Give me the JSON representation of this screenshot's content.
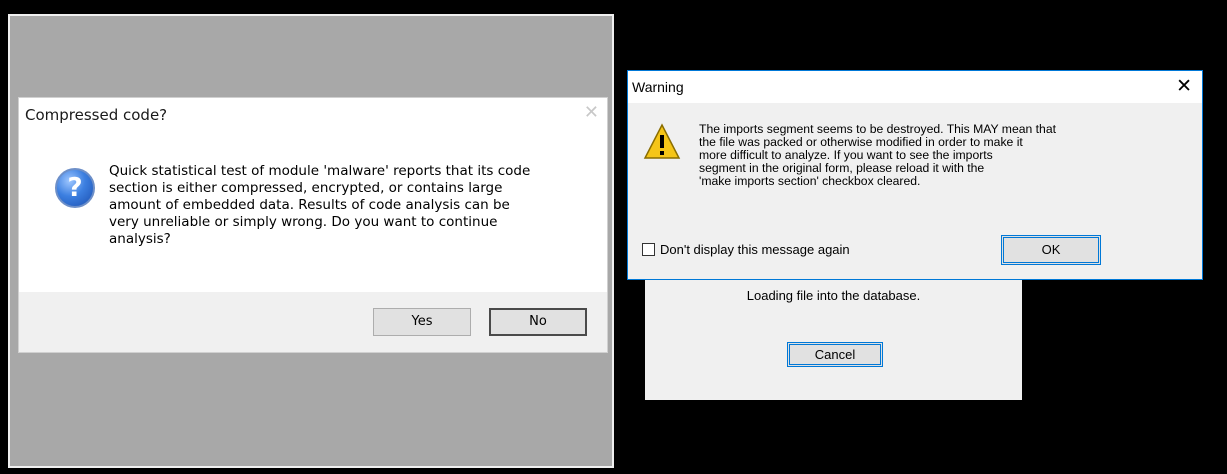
{
  "left_dialog": {
    "title": "Compressed code?",
    "close_glyph": "✕",
    "icon": "question-icon",
    "icon_glyph": "?",
    "message": "Quick statistical test of module 'malware' reports that its code\nsection is either compressed, encrypted, or contains large\namount of embedded data. Results of code analysis can be\nvery unreliable or simply wrong. Do you want to continue\nanalysis?",
    "yes_label": "Yes",
    "no_label": "No"
  },
  "loading_dialog": {
    "text": "Loading file into the database.",
    "cancel_label": "Cancel"
  },
  "warning_dialog": {
    "title": "Warning",
    "close_glyph": "✕",
    "icon": "warning-icon",
    "message": "The imports segment seems to be destroyed. This MAY mean that\nthe file was packed or otherwise modified in order to make it\nmore difficult to analyze. If you want to see the imports\nsegment in the original form, please reload it with the\n'make imports section' checkbox cleared.",
    "checkbox_label": "Don't display this message again",
    "checkbox_checked": false,
    "ok_label": "OK"
  },
  "colors": {
    "left_background": "#a8a8a8",
    "right_background": "#000000",
    "accent": "#0078d7",
    "warning_yellow": "#f5c518"
  }
}
